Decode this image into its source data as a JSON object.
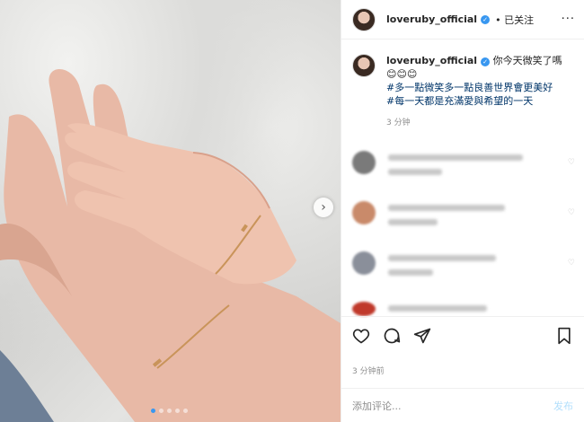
{
  "post": {
    "username": "loveruby_official",
    "follow_label": "• 已关注",
    "more_label": "···"
  },
  "caption": {
    "username": "loveruby_official",
    "line1": "你今天微笑了嗎",
    "emojis": "😊😊😊",
    "hashtag1": "#多一點微笑多一點良善世界會更美好",
    "hashtag2": "#每一天都是充滿愛與希望的一天",
    "time": "3 分钟"
  },
  "footer": {
    "post_time": "3 分钟前",
    "add_comment_placeholder": "添加评论...",
    "publish_label": "发布"
  },
  "icons": [
    "next-arrow-icon",
    "heart-icon",
    "comment-icon",
    "share-icon",
    "bookmark-icon",
    "verified-icon"
  ],
  "colors": {
    "accent": "#3897f0",
    "hashtag": "#003569",
    "muted": "#8e8e8e",
    "publish": "#b2dffc"
  }
}
